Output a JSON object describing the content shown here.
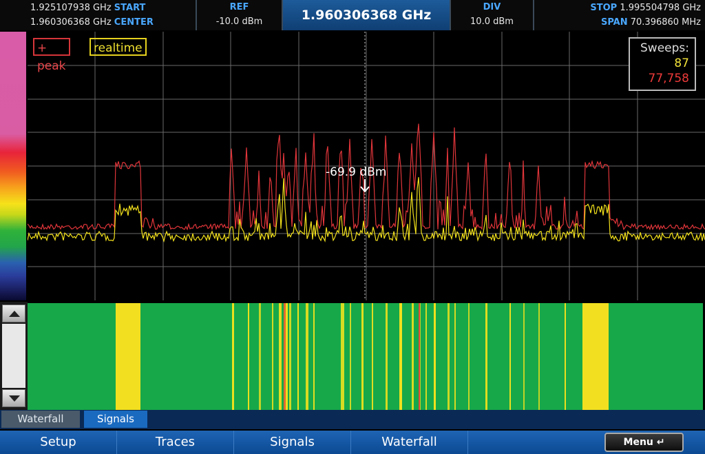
{
  "header": {
    "start_freq": "1.925107938 GHz",
    "start_label": "START",
    "center_freq": "1.960306368 GHz",
    "center_label": "CENTER",
    "ref_label": "REF",
    "ref_value": "-10.0 dBm",
    "center_display": "1.960306368 GHz",
    "div_label": "DIV",
    "div_value": "10.0 dBm",
    "stop_label": "STOP",
    "stop_freq": "1.995504798 GHz",
    "span_label": "SPAN",
    "span_value": "70.396860 MHz"
  },
  "legend": {
    "peak": "+ peak",
    "realtime": "realtime"
  },
  "sweeps": {
    "title": "Sweeps:",
    "realtime_count": "87",
    "peak_count": "77,758"
  },
  "marker": {
    "text": "-69.9 dBm"
  },
  "colors": {
    "peak_trace": "#e0353a",
    "realtime_trace": "#f4e21c",
    "grid": "#6a6a6a",
    "waterfall_bg": "#17a84a"
  },
  "chart_data": {
    "type": "line",
    "series": [
      {
        "name": "+ peak",
        "color": "#e0353a"
      },
      {
        "name": "realtime",
        "color": "#f4e21c"
      }
    ],
    "xlim": [
      1.925107938,
      1.995504798
    ],
    "ylim": [
      -120,
      -10
    ],
    "grid": true
  },
  "tabs": [
    {
      "label": "Waterfall"
    },
    {
      "label": "Signals"
    }
  ],
  "menu": {
    "items": [
      "Setup",
      "Traces",
      "Signals",
      "Waterfall"
    ],
    "menu_button": "Menu ↵"
  },
  "scroll": {
    "up_icon": "triangle-up-icon",
    "down_icon": "triangle-down-icon"
  }
}
